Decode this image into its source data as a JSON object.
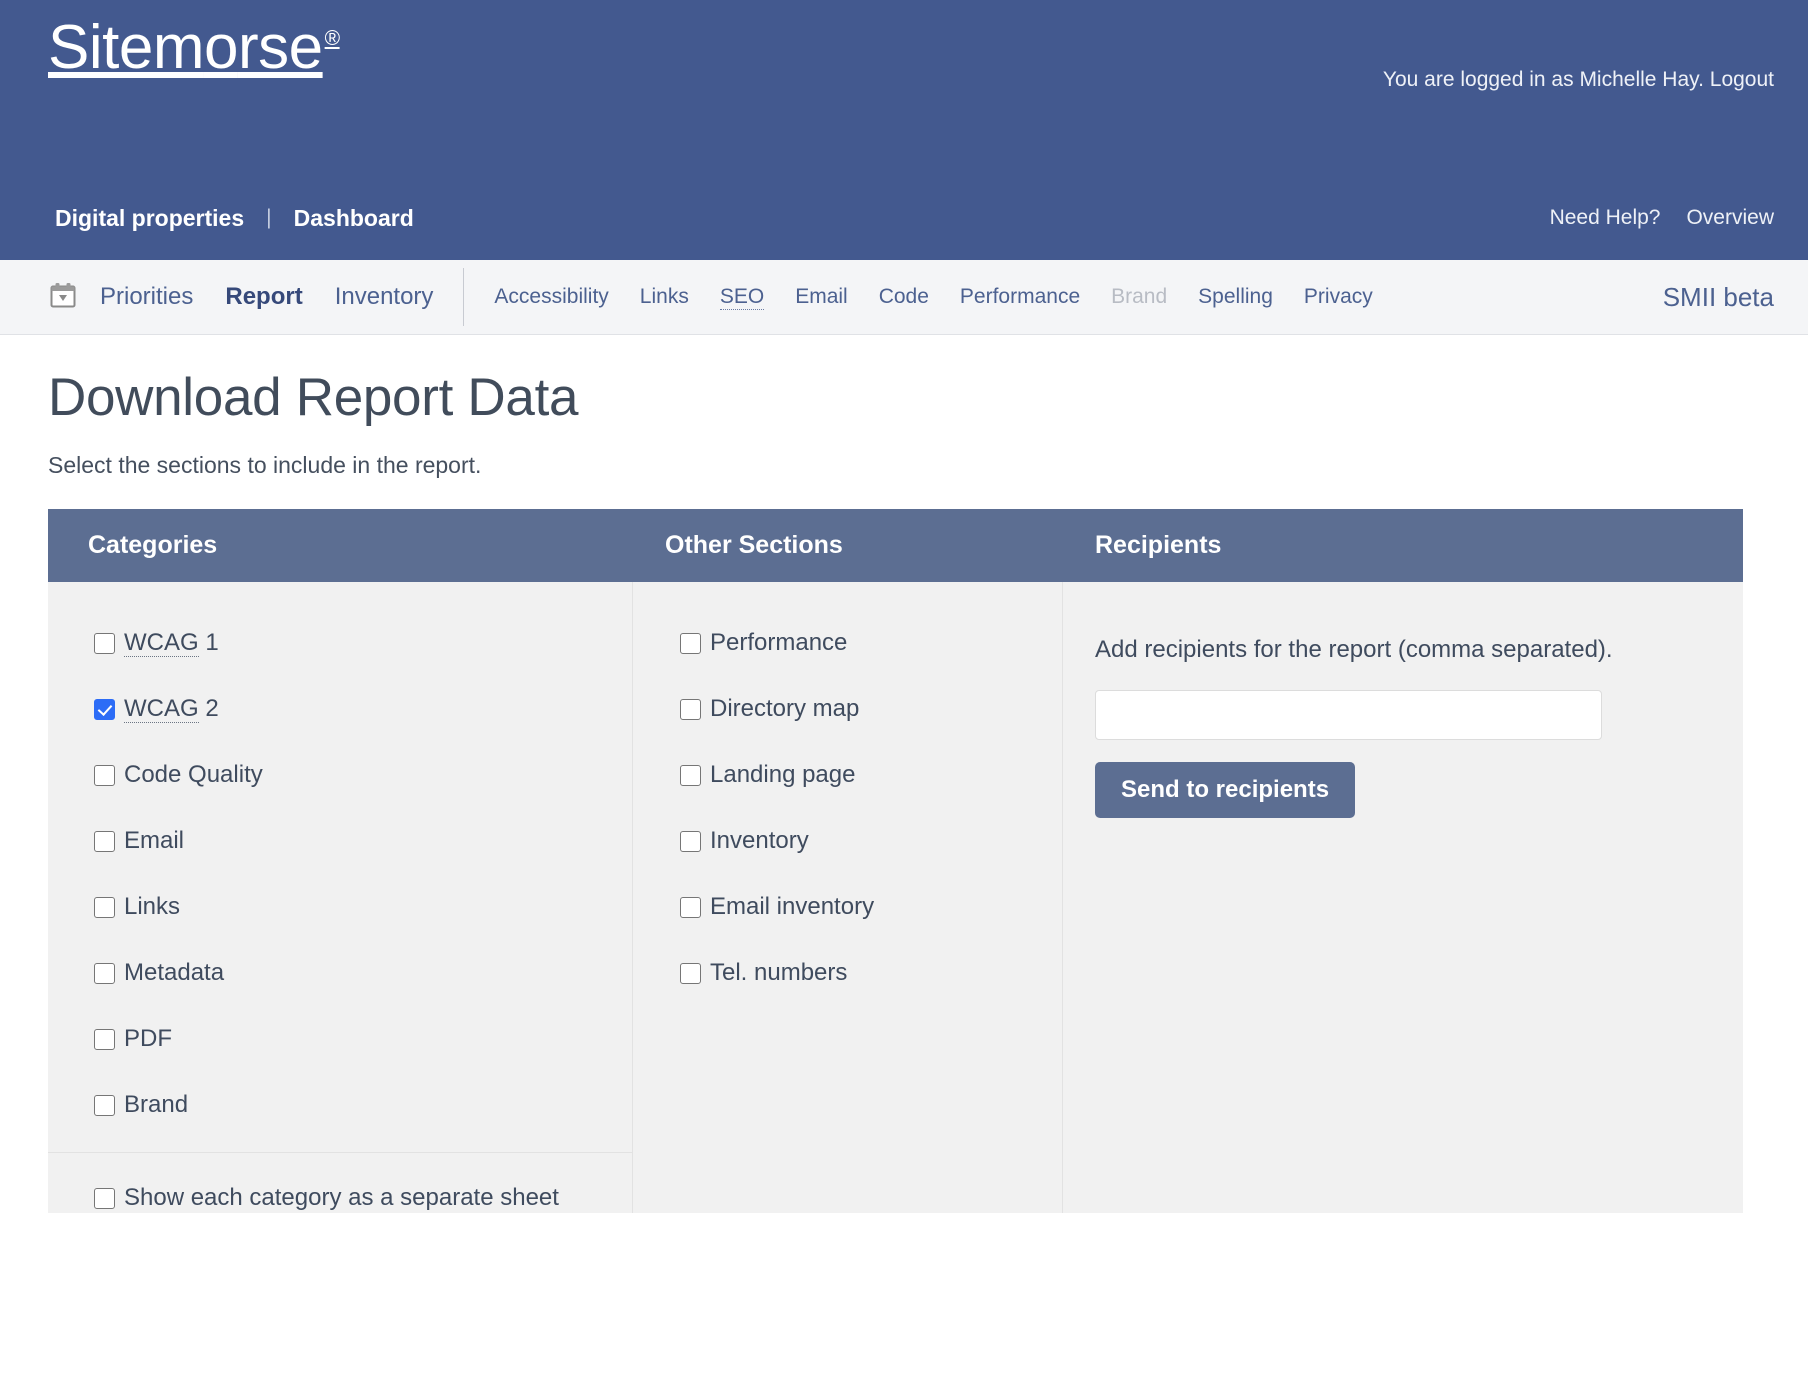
{
  "brand": {
    "logo_part1": "Sitem",
    "logo_o": "o",
    "logo_part2": "rse",
    "logo_reg": "®",
    "header_bg": "#43598f",
    "panel_header_bg": "#5c6e92",
    "accent_checkbox": "#2c6cf6"
  },
  "header": {
    "session_text": "You are logged in as Michelle Hay. ",
    "logout_label": "Logout",
    "nav": {
      "digital_properties": "Digital properties",
      "separator": "|",
      "dashboard": "Dashboard",
      "need_help": "Need Help?",
      "overview": "Overview"
    }
  },
  "tabbar": {
    "calendar_icon": "calendar-dropdown-icon",
    "primary": [
      {
        "label": "Priorities",
        "active": false
      },
      {
        "label": "Report",
        "active": true
      },
      {
        "label": "Inventory",
        "active": false
      }
    ],
    "secondary": [
      {
        "label": "Accessibility",
        "state": "normal"
      },
      {
        "label": "Links",
        "state": "normal"
      },
      {
        "label": "SEO",
        "state": "abbr"
      },
      {
        "label": "Email",
        "state": "normal"
      },
      {
        "label": "Code",
        "state": "normal"
      },
      {
        "label": "Performance",
        "state": "normal"
      },
      {
        "label": "Brand",
        "state": "disabled"
      },
      {
        "label": "Spelling",
        "state": "normal"
      },
      {
        "label": "Privacy",
        "state": "normal"
      }
    ],
    "beta_label": "SMII beta"
  },
  "page": {
    "title": "Download Report Data",
    "subtitle": "Select the sections to include in the report."
  },
  "panel": {
    "headers": {
      "categories": "Categories",
      "other_sections": "Other Sections",
      "recipients": "Recipients"
    },
    "categories": [
      {
        "label": "WCAG 1",
        "abbr": "WCAG",
        "rest": " 1",
        "checked": false
      },
      {
        "label": "WCAG 2",
        "abbr": "WCAG",
        "rest": " 2",
        "checked": true
      },
      {
        "label": "Code Quality",
        "checked": false
      },
      {
        "label": "Email",
        "checked": false
      },
      {
        "label": "Links",
        "checked": false
      },
      {
        "label": "Metadata",
        "checked": false
      },
      {
        "label": "PDF",
        "checked": false
      },
      {
        "label": "Brand",
        "checked": false
      }
    ],
    "separate_sheet": {
      "label": "Show each category as a separate sheet",
      "checked": false
    },
    "other_sections": [
      {
        "label": "Performance",
        "checked": false
      },
      {
        "label": "Directory map",
        "checked": false
      },
      {
        "label": "Landing page",
        "checked": false
      },
      {
        "label": "Inventory",
        "checked": false
      },
      {
        "label": "Email inventory",
        "checked": false
      },
      {
        "label": "Tel. numbers",
        "checked": false
      }
    ],
    "recipients": {
      "instruction": "Add recipients for the report (comma separated).",
      "input_value": "",
      "input_placeholder": "",
      "send_label": "Send to recipients"
    }
  }
}
